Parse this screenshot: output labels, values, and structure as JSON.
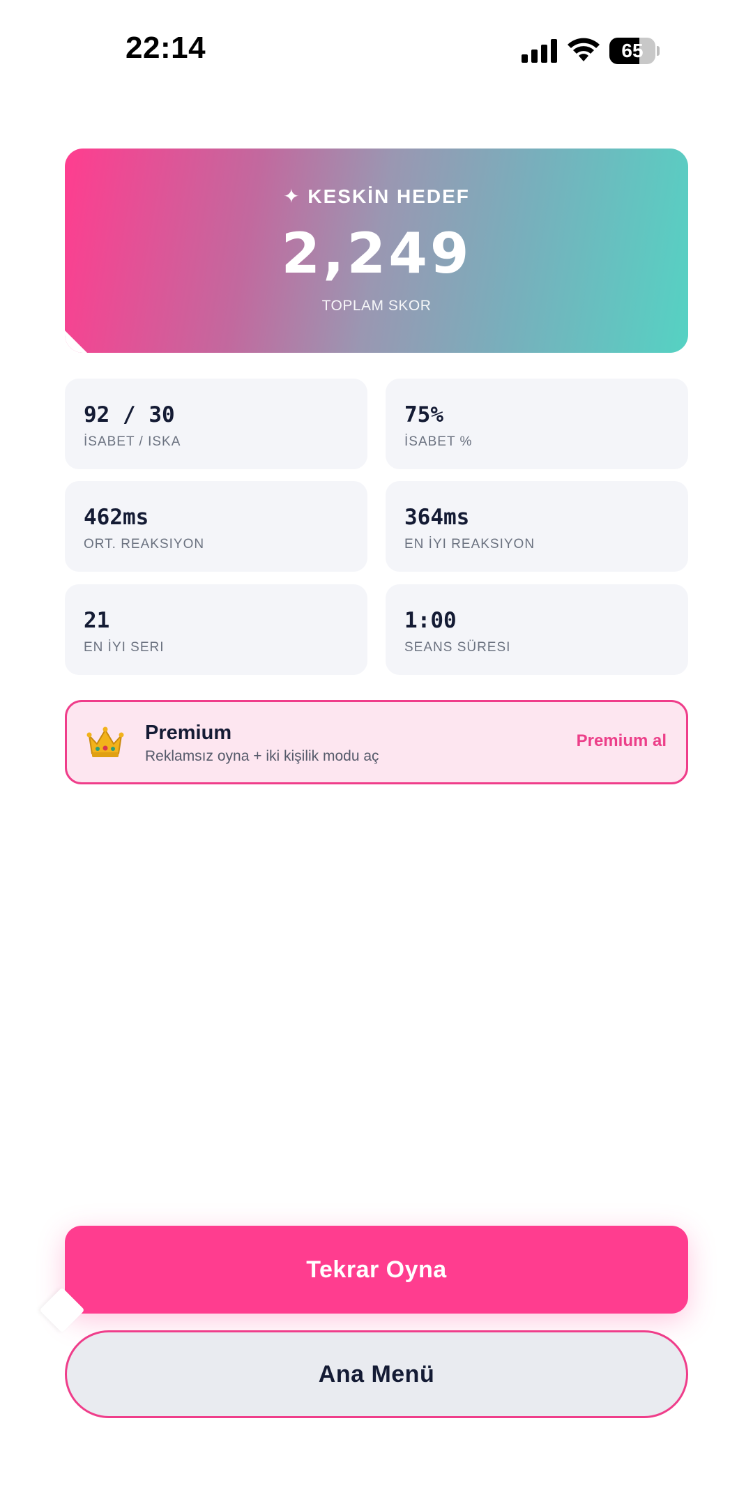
{
  "status_bar": {
    "time": "22:14",
    "battery": "65",
    "battery_level": 0.65
  },
  "hero": {
    "title": "✦ KESKİN HEDEF",
    "score": "2,249",
    "score_label": "TOPLAM SKOR",
    "gradient_start": "#ff3d8f",
    "gradient_end": "#55d2c3"
  },
  "stats": [
    {
      "value": "92 / 30",
      "label": "İSABET / ISKA"
    },
    {
      "value": "75%",
      "label": "İSABET %"
    },
    {
      "value": "462ms",
      "label": "ORT. REAKSIYON"
    },
    {
      "value": "364ms",
      "label": "EN İYI REAKSIYON"
    },
    {
      "value": "21",
      "label": "EN İYI SERI"
    },
    {
      "value": "1:00",
      "label": "SEANS SÜRESI"
    }
  ],
  "premium": {
    "icon": "crown-icon",
    "title": "Premium",
    "description": "Reklamsız oyna + iki kişilik modu aç",
    "cta": "Premium al"
  },
  "buttons": {
    "play_again": "Tekrar Oyna",
    "main_menu": "Ana Menü"
  },
  "colors": {
    "accent": "#ff3d8f",
    "teal": "#55d2c3",
    "text_dark": "#141b34",
    "card_bg": "#f4f5f9",
    "premium_bg": "#fde6f0"
  }
}
